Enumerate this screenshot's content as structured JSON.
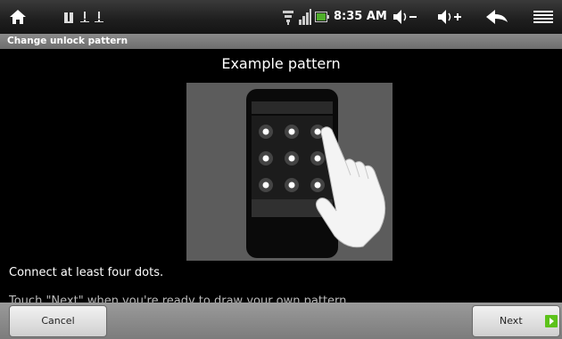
{
  "status_bar": {
    "time": "8:35 AM",
    "icons": [
      "home-icon",
      "notification-usb-icon",
      "notification-warning-icon",
      "notification-warning-icon",
      "wifi-icon",
      "signal-icon",
      "battery-icon",
      "volume-down-icon",
      "volume-up-icon",
      "back-icon",
      "menu-icon"
    ]
  },
  "title_bar": {
    "title": "Change unlock pattern"
  },
  "main": {
    "heading": "Example pattern",
    "instruction": "Connect at least four dots.",
    "hint": "Touch \"Next\" when you're ready to draw your own pattern."
  },
  "buttons": {
    "cancel": "Cancel",
    "next": "Next"
  },
  "colors": {
    "accent_green": "#5cc21a"
  }
}
